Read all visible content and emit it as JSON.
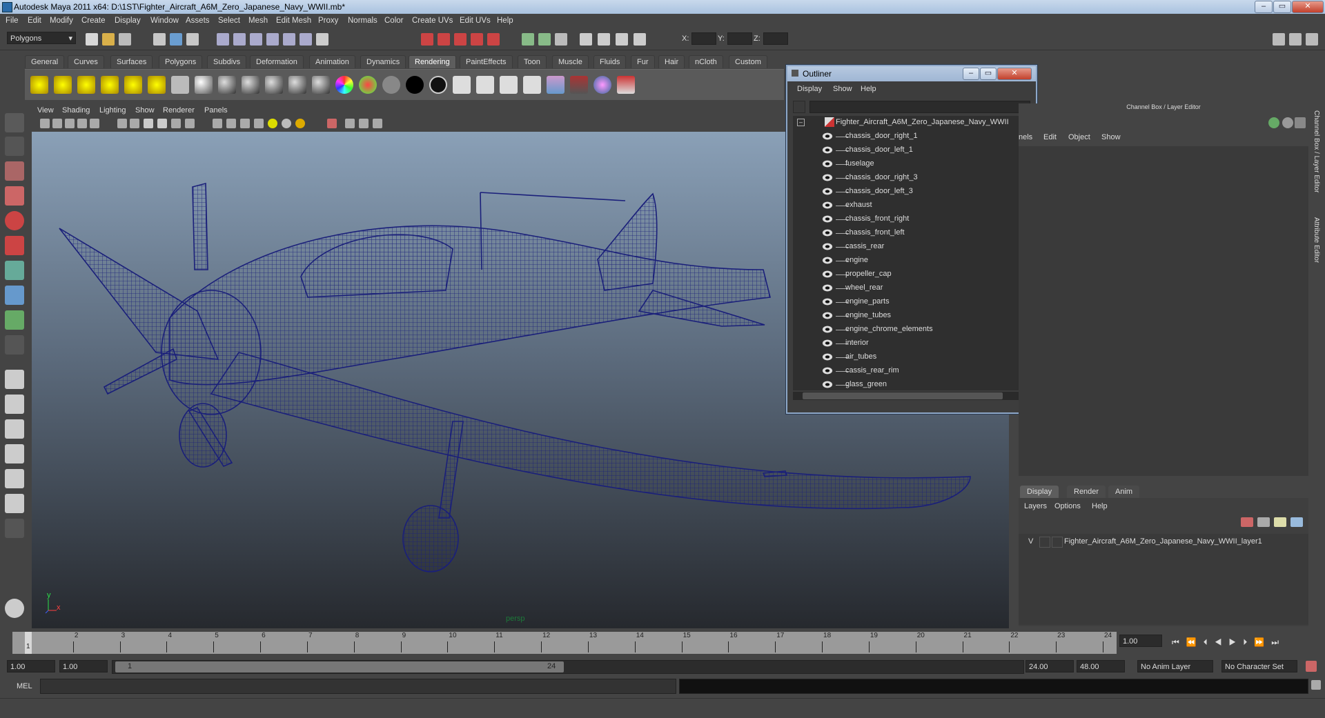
{
  "window": {
    "title": "Autodesk Maya 2011 x64: D:\\1ST\\Fighter_Aircraft_A6M_Zero_Japanese_Navy_WWII.mb*"
  },
  "menubar": [
    "File",
    "Edit",
    "Modify",
    "Create",
    "Display",
    "Window",
    "Assets",
    "Select",
    "Mesh",
    "Edit Mesh",
    "Proxy",
    "Normals",
    "Color",
    "Create UVs",
    "Edit UVs",
    "Help"
  ],
  "statusline": {
    "menuset": "Polygons",
    "x_label": "X:",
    "y_label": "Y:",
    "z_label": "Z:"
  },
  "shelf_tabs": [
    "General",
    "Curves",
    "Surfaces",
    "Polygons",
    "Subdivs",
    "Deformation",
    "Animation",
    "Dynamics",
    "Rendering",
    "PaintEffects",
    "Toon",
    "Muscle",
    "Fluids",
    "Fur",
    "Hair",
    "nCloth",
    "Custom"
  ],
  "shelf_active": "Rendering",
  "viewport": {
    "menu": [
      "View",
      "Shading",
      "Lighting",
      "Show",
      "Renderer",
      "Panels"
    ],
    "camera_label": "persp",
    "axis_y": "y",
    "axis_x": "x"
  },
  "outliner": {
    "title": "Outliner",
    "menu": [
      "Display",
      "Show",
      "Help"
    ],
    "root": "Fighter_Aircraft_A6M_Zero_Japanese_Navy_WWII",
    "items": [
      "chassis_door_right_1",
      "chassis_door_left_1",
      "fuselage",
      "chassis_door_right_3",
      "chassis_door_left_3",
      "exhaust",
      "chassis_front_right",
      "chassis_front_left",
      "cassis_rear",
      "engine",
      "propeller_cap",
      "wheel_rear",
      "engine_parts",
      "engine_tubes",
      "engine_chrome_elements",
      "interior",
      "air_tubes",
      "cassis_rear_rim",
      "glass_green"
    ]
  },
  "channelbox": {
    "title": "Channel Box / Layer Editor",
    "menu": [
      "nels",
      "Edit",
      "Object",
      "Show"
    ],
    "side_labels": [
      "Channel Box / Layer Editor",
      "Attribute Editor"
    ]
  },
  "layers": {
    "tabs": [
      "Display",
      "Render",
      "Anim"
    ],
    "active_tab": "Display",
    "menu": [
      "Layers",
      "Options",
      "Help"
    ],
    "visible_flag": "V",
    "layer_name": "Fighter_Aircraft_A6M_Zero_Japanese_Navy_WWII_layer1"
  },
  "timeline": {
    "ticks": [
      "1",
      "2",
      "3",
      "4",
      "5",
      "6",
      "7",
      "8",
      "9",
      "10",
      "11",
      "12",
      "13",
      "14",
      "15",
      "16",
      "17",
      "18",
      "19",
      "20",
      "21",
      "22",
      "23",
      "24"
    ],
    "current_frame_marker": "1",
    "current_time": "1.00",
    "range_start": "1.00",
    "range_start2": "1.00",
    "range_slider_start": "1",
    "range_slider_end": "24",
    "range_end": "24.00",
    "range_end2": "48.00",
    "anim_layer": "No Anim Layer",
    "character_set": "No Character Set"
  },
  "cmdline": {
    "label": "MEL"
  },
  "colors": {
    "wire": "#1a1f7a",
    "accent": "#8ea8c8"
  }
}
